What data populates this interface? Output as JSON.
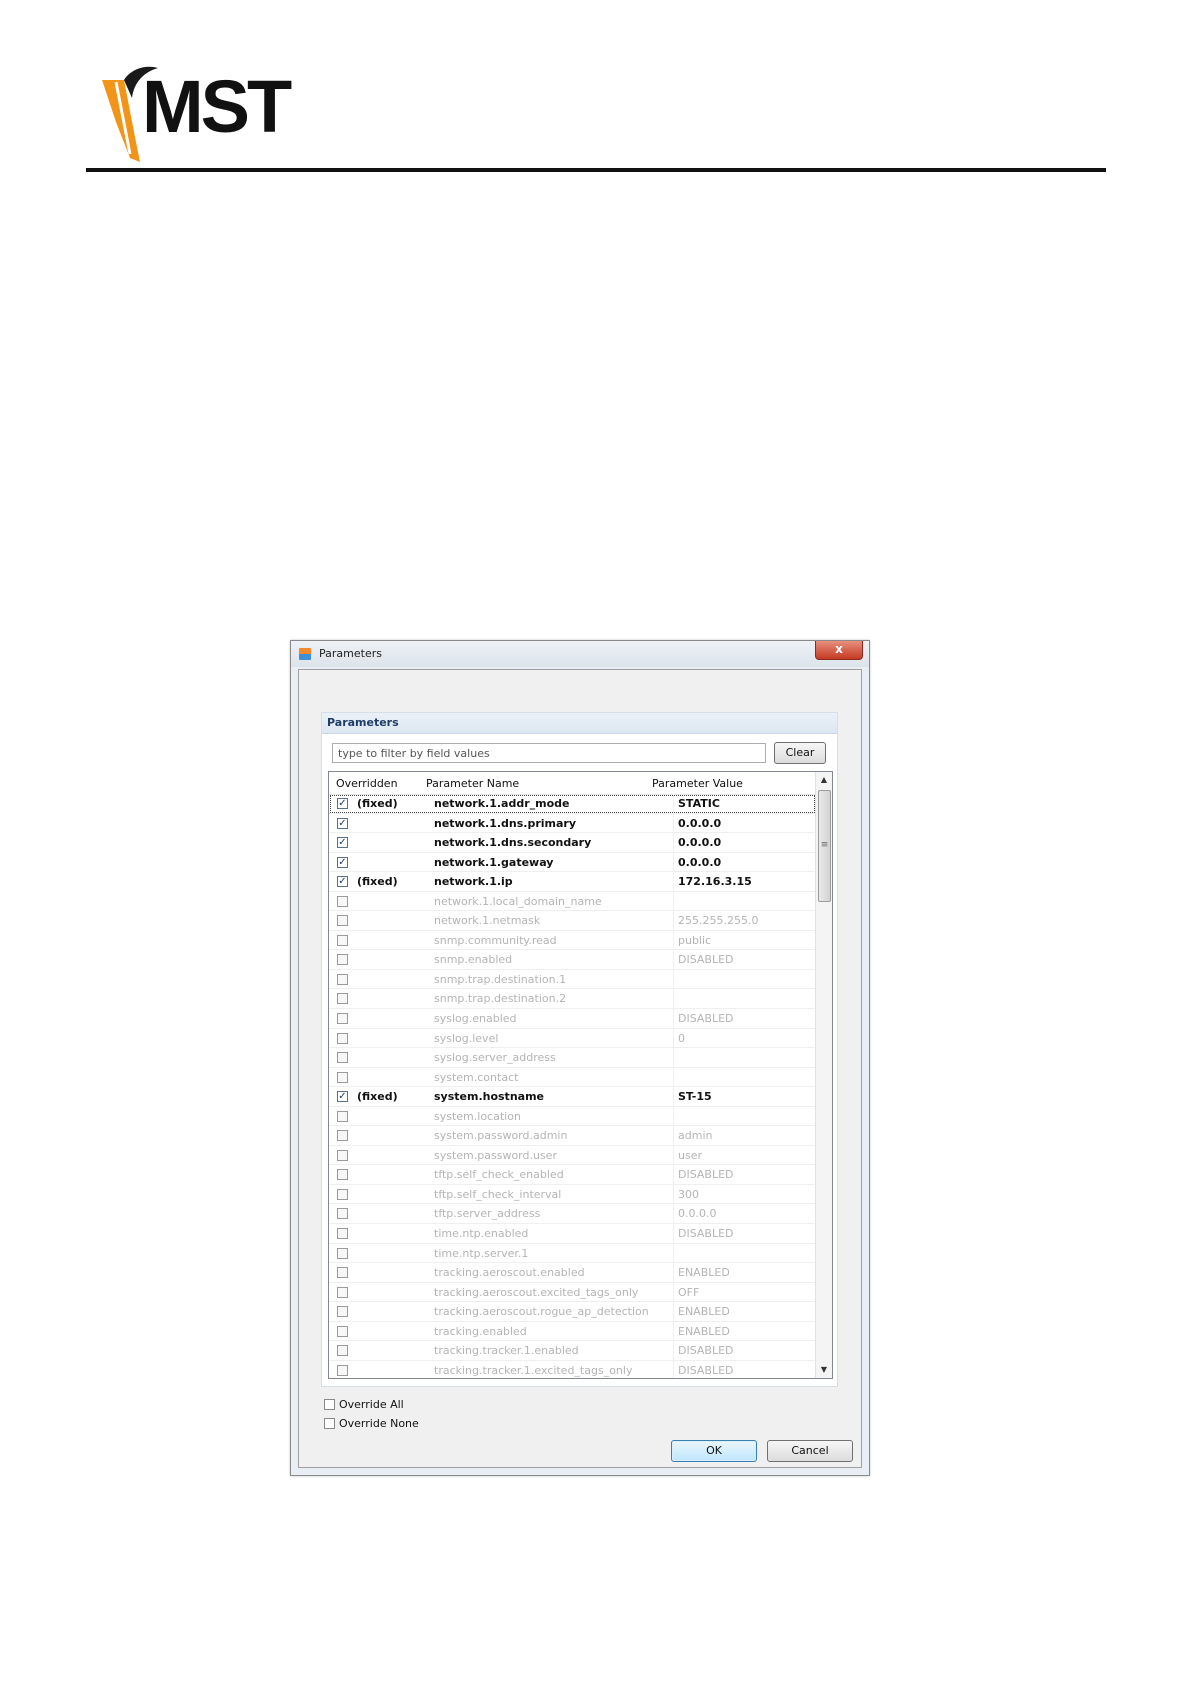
{
  "header": {
    "logo_text": "MST"
  },
  "dialog": {
    "title": "Parameters",
    "close_glyph": "x",
    "group_title": "Parameters",
    "filter_placeholder": "type to filter by field values",
    "clear_label": "Clear",
    "columns": [
      "Overridden",
      "Parameter Name",
      "Parameter Value"
    ],
    "rows": [
      {
        "checked": true,
        "fixed": "(fixed)",
        "name": "network.1.addr_mode",
        "value": "STATIC",
        "selected": true
      },
      {
        "checked": true,
        "fixed": "",
        "name": "network.1.dns.primary",
        "value": "0.0.0.0"
      },
      {
        "checked": true,
        "fixed": "",
        "name": "network.1.dns.secondary",
        "value": "0.0.0.0"
      },
      {
        "checked": true,
        "fixed": "",
        "name": "network.1.gateway",
        "value": "0.0.0.0"
      },
      {
        "checked": true,
        "fixed": "(fixed)",
        "name": "network.1.ip",
        "value": "172.16.3.15"
      },
      {
        "checked": false,
        "fixed": "",
        "name": "network.1.local_domain_name",
        "value": ""
      },
      {
        "checked": false,
        "fixed": "",
        "name": "network.1.netmask",
        "value": "255.255.255.0"
      },
      {
        "checked": false,
        "fixed": "",
        "name": "snmp.community.read",
        "value": "public"
      },
      {
        "checked": false,
        "fixed": "",
        "name": "snmp.enabled",
        "value": "DISABLED"
      },
      {
        "checked": false,
        "fixed": "",
        "name": "snmp.trap.destination.1",
        "value": ""
      },
      {
        "checked": false,
        "fixed": "",
        "name": "snmp.trap.destination.2",
        "value": ""
      },
      {
        "checked": false,
        "fixed": "",
        "name": "syslog.enabled",
        "value": "DISABLED"
      },
      {
        "checked": false,
        "fixed": "",
        "name": "syslog.level",
        "value": "0"
      },
      {
        "checked": false,
        "fixed": "",
        "name": "syslog.server_address",
        "value": ""
      },
      {
        "checked": false,
        "fixed": "",
        "name": "system.contact",
        "value": ""
      },
      {
        "checked": true,
        "fixed": "(fixed)",
        "name": "system.hostname",
        "value": "ST-15"
      },
      {
        "checked": false,
        "fixed": "",
        "name": "system.location",
        "value": ""
      },
      {
        "checked": false,
        "fixed": "",
        "name": "system.password.admin",
        "value": "admin"
      },
      {
        "checked": false,
        "fixed": "",
        "name": "system.password.user",
        "value": "user"
      },
      {
        "checked": false,
        "fixed": "",
        "name": "tftp.self_check_enabled",
        "value": "DISABLED"
      },
      {
        "checked": false,
        "fixed": "",
        "name": "tftp.self_check_interval",
        "value": "300"
      },
      {
        "checked": false,
        "fixed": "",
        "name": "tftp.server_address",
        "value": "0.0.0.0"
      },
      {
        "checked": false,
        "fixed": "",
        "name": "time.ntp.enabled",
        "value": "DISABLED"
      },
      {
        "checked": false,
        "fixed": "",
        "name": "time.ntp.server.1",
        "value": ""
      },
      {
        "checked": false,
        "fixed": "",
        "name": "tracking.aeroscout.enabled",
        "value": "ENABLED"
      },
      {
        "checked": false,
        "fixed": "",
        "name": "tracking.aeroscout.excited_tags_only",
        "value": "OFF"
      },
      {
        "checked": false,
        "fixed": "",
        "name": "tracking.aeroscout.rogue_ap_detection",
        "value": "ENABLED"
      },
      {
        "checked": false,
        "fixed": "",
        "name": "tracking.enabled",
        "value": "ENABLED"
      },
      {
        "checked": false,
        "fixed": "",
        "name": "tracking.tracker.1.enabled",
        "value": "DISABLED"
      },
      {
        "checked": false,
        "fixed": "",
        "name": "tracking.tracker.1.excited_tags_only",
        "value": "DISABLED"
      }
    ],
    "override_all_label": "Override All",
    "override_none_label": "Override None",
    "ok_label": "OK",
    "cancel_label": "Cancel"
  }
}
